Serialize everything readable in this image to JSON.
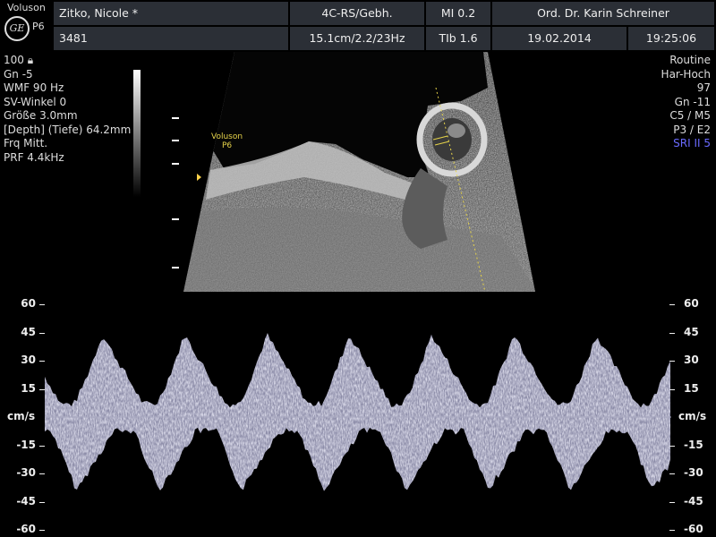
{
  "logo": {
    "brand": "Voluson",
    "mark": "GE",
    "probe": "P6"
  },
  "header": {
    "patient_name": "Zitko, Nicole  *",
    "mode": "4C-RS/Gebh.",
    "mi": "MI  0.2",
    "doctor": "Ord. Dr. Karin Schreiner",
    "patient_id": "3481",
    "depth_freq": "15.1cm/2.2/23Hz",
    "tib": "TIb  1.6",
    "date": "19.02.2014",
    "time": "19:25:06"
  },
  "params_left": [
    "100",
    "Gn  -5",
    "WMF 90 Hz",
    "SV-Winkel  0",
    "Größe  3.0mm",
    "[Depth] (Tiefe) 64.2mm",
    "Frq Mitt.",
    "PRF  4.4kHz"
  ],
  "params_right": [
    "Routine",
    "Har-Hoch",
    "97",
    "Gn -11",
    "C5 / M5",
    "P3 / E2",
    "SRI II 5"
  ],
  "image_label": {
    "brand": "Voluson",
    "probe": "P6"
  },
  "colors": {
    "header_bg": "#2b2f36",
    "sri": "#6a6aff",
    "probe_label": "#e6d34a",
    "cursor": "#e6d34a"
  },
  "doppler": {
    "unit": "cm/s",
    "ticks_left": [
      "60",
      "45",
      "30",
      "15",
      "-15",
      "-30",
      "-45",
      "-60"
    ],
    "ticks_right": [
      "60",
      "45",
      "30",
      "15",
      "-15",
      "-30",
      "-45",
      "-60"
    ],
    "range": [
      -60,
      60
    ]
  }
}
